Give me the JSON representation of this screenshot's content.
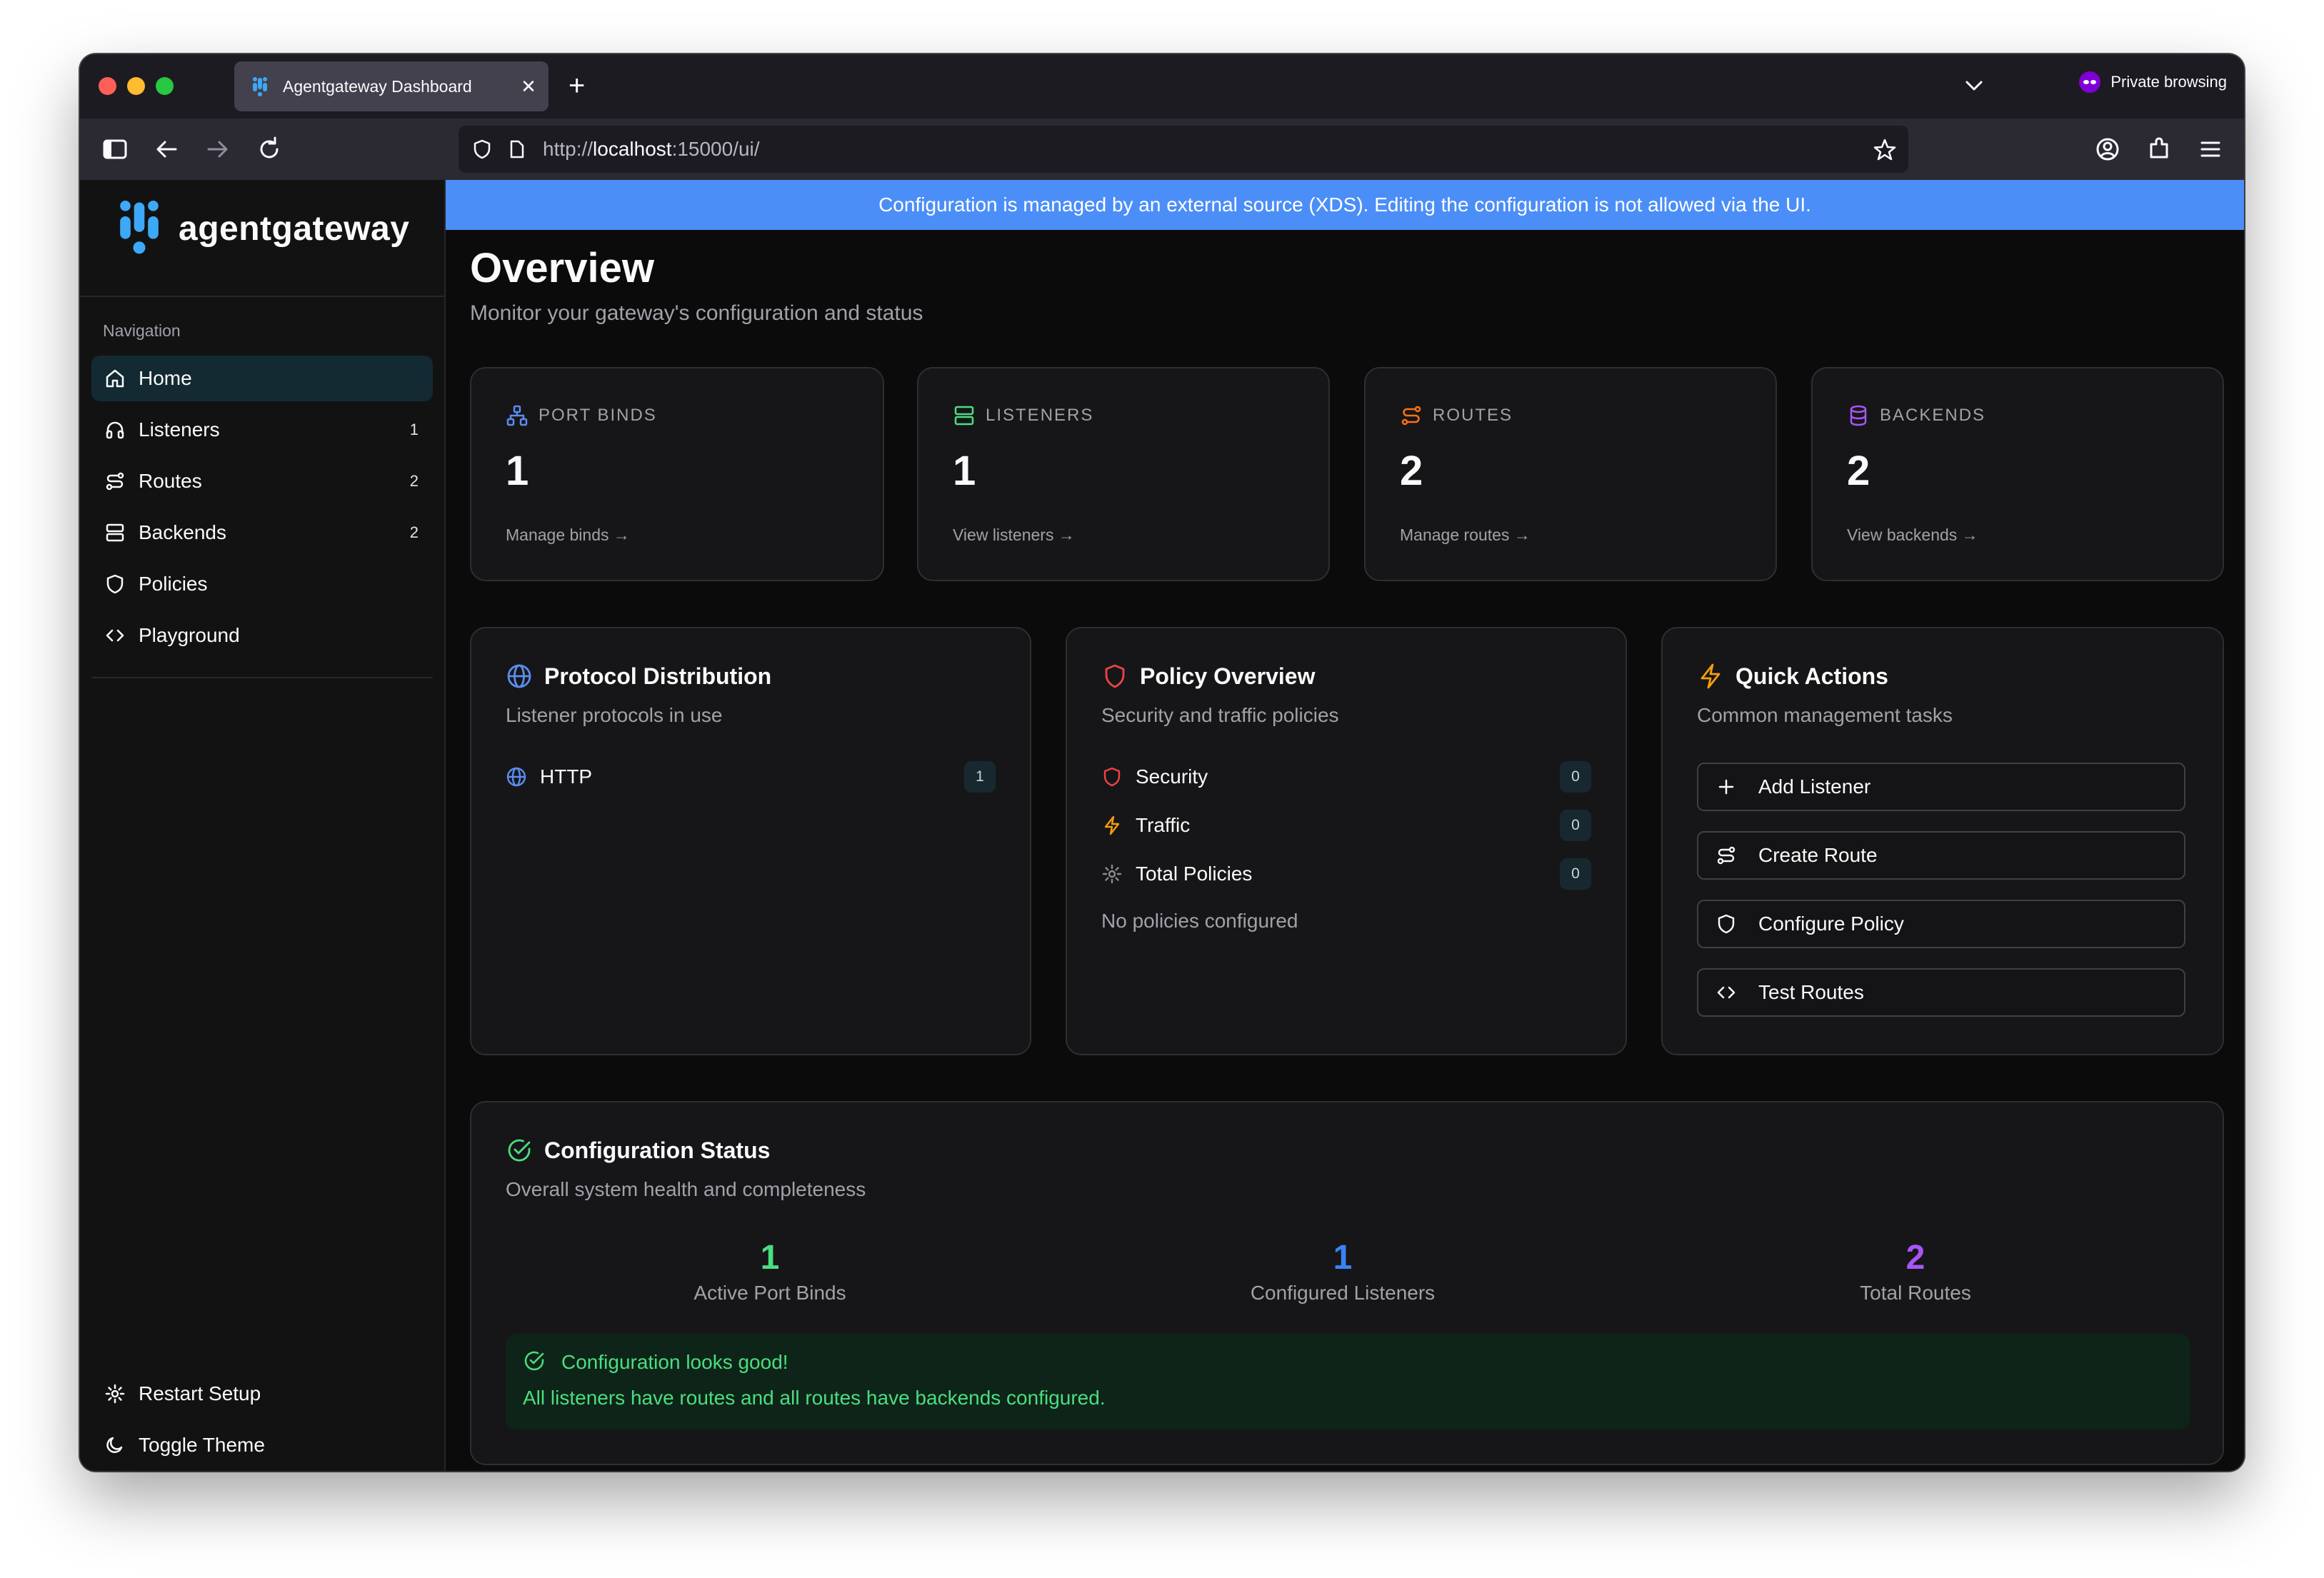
{
  "browser": {
    "tab_title": "Agentgateway Dashboard",
    "private_label": "Private browsing",
    "url_scheme": "http://",
    "url_host": "localhost",
    "url_rest": ":15000/ui/"
  },
  "sidebar": {
    "brand": "agentgateway",
    "nav_heading": "Navigation",
    "items": [
      {
        "label": "Home",
        "icon": "home-icon",
        "count": ""
      },
      {
        "label": "Listeners",
        "icon": "headphones-icon",
        "count": "1"
      },
      {
        "label": "Routes",
        "icon": "route-icon",
        "count": "2"
      },
      {
        "label": "Backends",
        "icon": "server-icon",
        "count": "2"
      },
      {
        "label": "Policies",
        "icon": "shield-icon",
        "count": ""
      },
      {
        "label": "Playground",
        "icon": "code-icon",
        "count": ""
      }
    ],
    "footer": [
      {
        "label": "Restart Setup",
        "icon": "gear-icon"
      },
      {
        "label": "Toggle Theme",
        "icon": "moon-icon"
      }
    ]
  },
  "banner": "Configuration is managed by an external source (XDS). Editing the configuration is not allowed via the UI.",
  "page": {
    "title": "Overview",
    "subtitle": "Monitor your gateway's configuration and status"
  },
  "stats": [
    {
      "label": "PORT BINDS",
      "value": "1",
      "link": "Manage binds →",
      "icon": "network-icon",
      "color": "#5b8def"
    },
    {
      "label": "LISTENERS",
      "value": "1",
      "link": "View listeners →",
      "icon": "server-icon",
      "color": "#4ade80"
    },
    {
      "label": "ROUTES",
      "value": "2",
      "link": "Manage routes →",
      "icon": "route-icon",
      "color": "#f97316"
    },
    {
      "label": "BACKENDS",
      "value": "2",
      "link": "View backends →",
      "icon": "database-icon",
      "color": "#a855f7"
    }
  ],
  "protocol": {
    "title": "Protocol Distribution",
    "subtitle": "Listener protocols in use",
    "rows": [
      {
        "label": "HTTP",
        "count": "1"
      }
    ]
  },
  "policy": {
    "title": "Policy Overview",
    "subtitle": "Security and traffic policies",
    "rows": [
      {
        "label": "Security",
        "count": "0"
      },
      {
        "label": "Traffic",
        "count": "0"
      },
      {
        "label": "Total Policies",
        "count": "0"
      }
    ],
    "empty_note": "No policies configured"
  },
  "quick_actions": {
    "title": "Quick Actions",
    "subtitle": "Common management tasks",
    "buttons": [
      "Add Listener",
      "Create Route",
      "Configure Policy",
      "Test Routes"
    ]
  },
  "config_status": {
    "title": "Configuration Status",
    "subtitle": "Overall system health and completeness",
    "metrics": [
      {
        "value": "1",
        "label": "Active Port Binds",
        "color": "#4ade80"
      },
      {
        "value": "1",
        "label": "Configured Listeners",
        "color": "#3b82f6"
      },
      {
        "value": "2",
        "label": "Total Routes",
        "color": "#a855f7"
      }
    ],
    "ok_title": "Configuration looks good!",
    "ok_desc": "All listeners have routes and all routes have backends configured."
  }
}
